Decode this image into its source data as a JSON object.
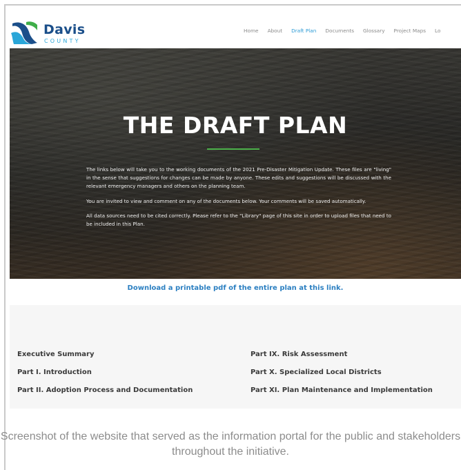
{
  "logo": {
    "name": "Davis",
    "sub": "COUNTY"
  },
  "nav": [
    {
      "label": "Home",
      "active": false
    },
    {
      "label": "About",
      "active": false
    },
    {
      "label": "Draft Plan",
      "active": true
    },
    {
      "label": "Documents",
      "active": false
    },
    {
      "label": "Glossary",
      "active": false
    },
    {
      "label": "Project Maps",
      "active": false
    },
    {
      "label": "Lo",
      "active": false
    }
  ],
  "hero": {
    "title": "THE DRAFT PLAN",
    "paragraphs": [
      "The links below will take you to the working documents of the 2021 Pre-Disaster Mitigation Update. These files are \"living\" in the sense that suggestions for changes can be made by anyone. These edits and suggestions will be discussed with the relevant emergency managers and others on the planning team.",
      "You are invited to view and comment on any of the documents below. Your comments will be saved automatically.",
      "All data sources need to be cited correctly. Please refer to the \"Library\" page of this site in order to upload files that need to be included in this Plan."
    ]
  },
  "download_link": "Download a printable pdf of the entire plan at this link.",
  "parts_left": [
    "Executive Summary",
    "Part I. Introduction",
    "Part II. Adoption Process and Documentation"
  ],
  "parts_right": [
    "Part IX. Risk Assessment",
    "Part X. Specialized Local Districts",
    "Part XI. Plan Maintenance and Implementation"
  ],
  "caption": "Screenshot of the website that served as the information portal for the public and stakeholders throughout the initiative.",
  "colors": {
    "brand": "#1b4f8a",
    "accent": "#2c9bd6",
    "rule": "#4cb24a"
  }
}
